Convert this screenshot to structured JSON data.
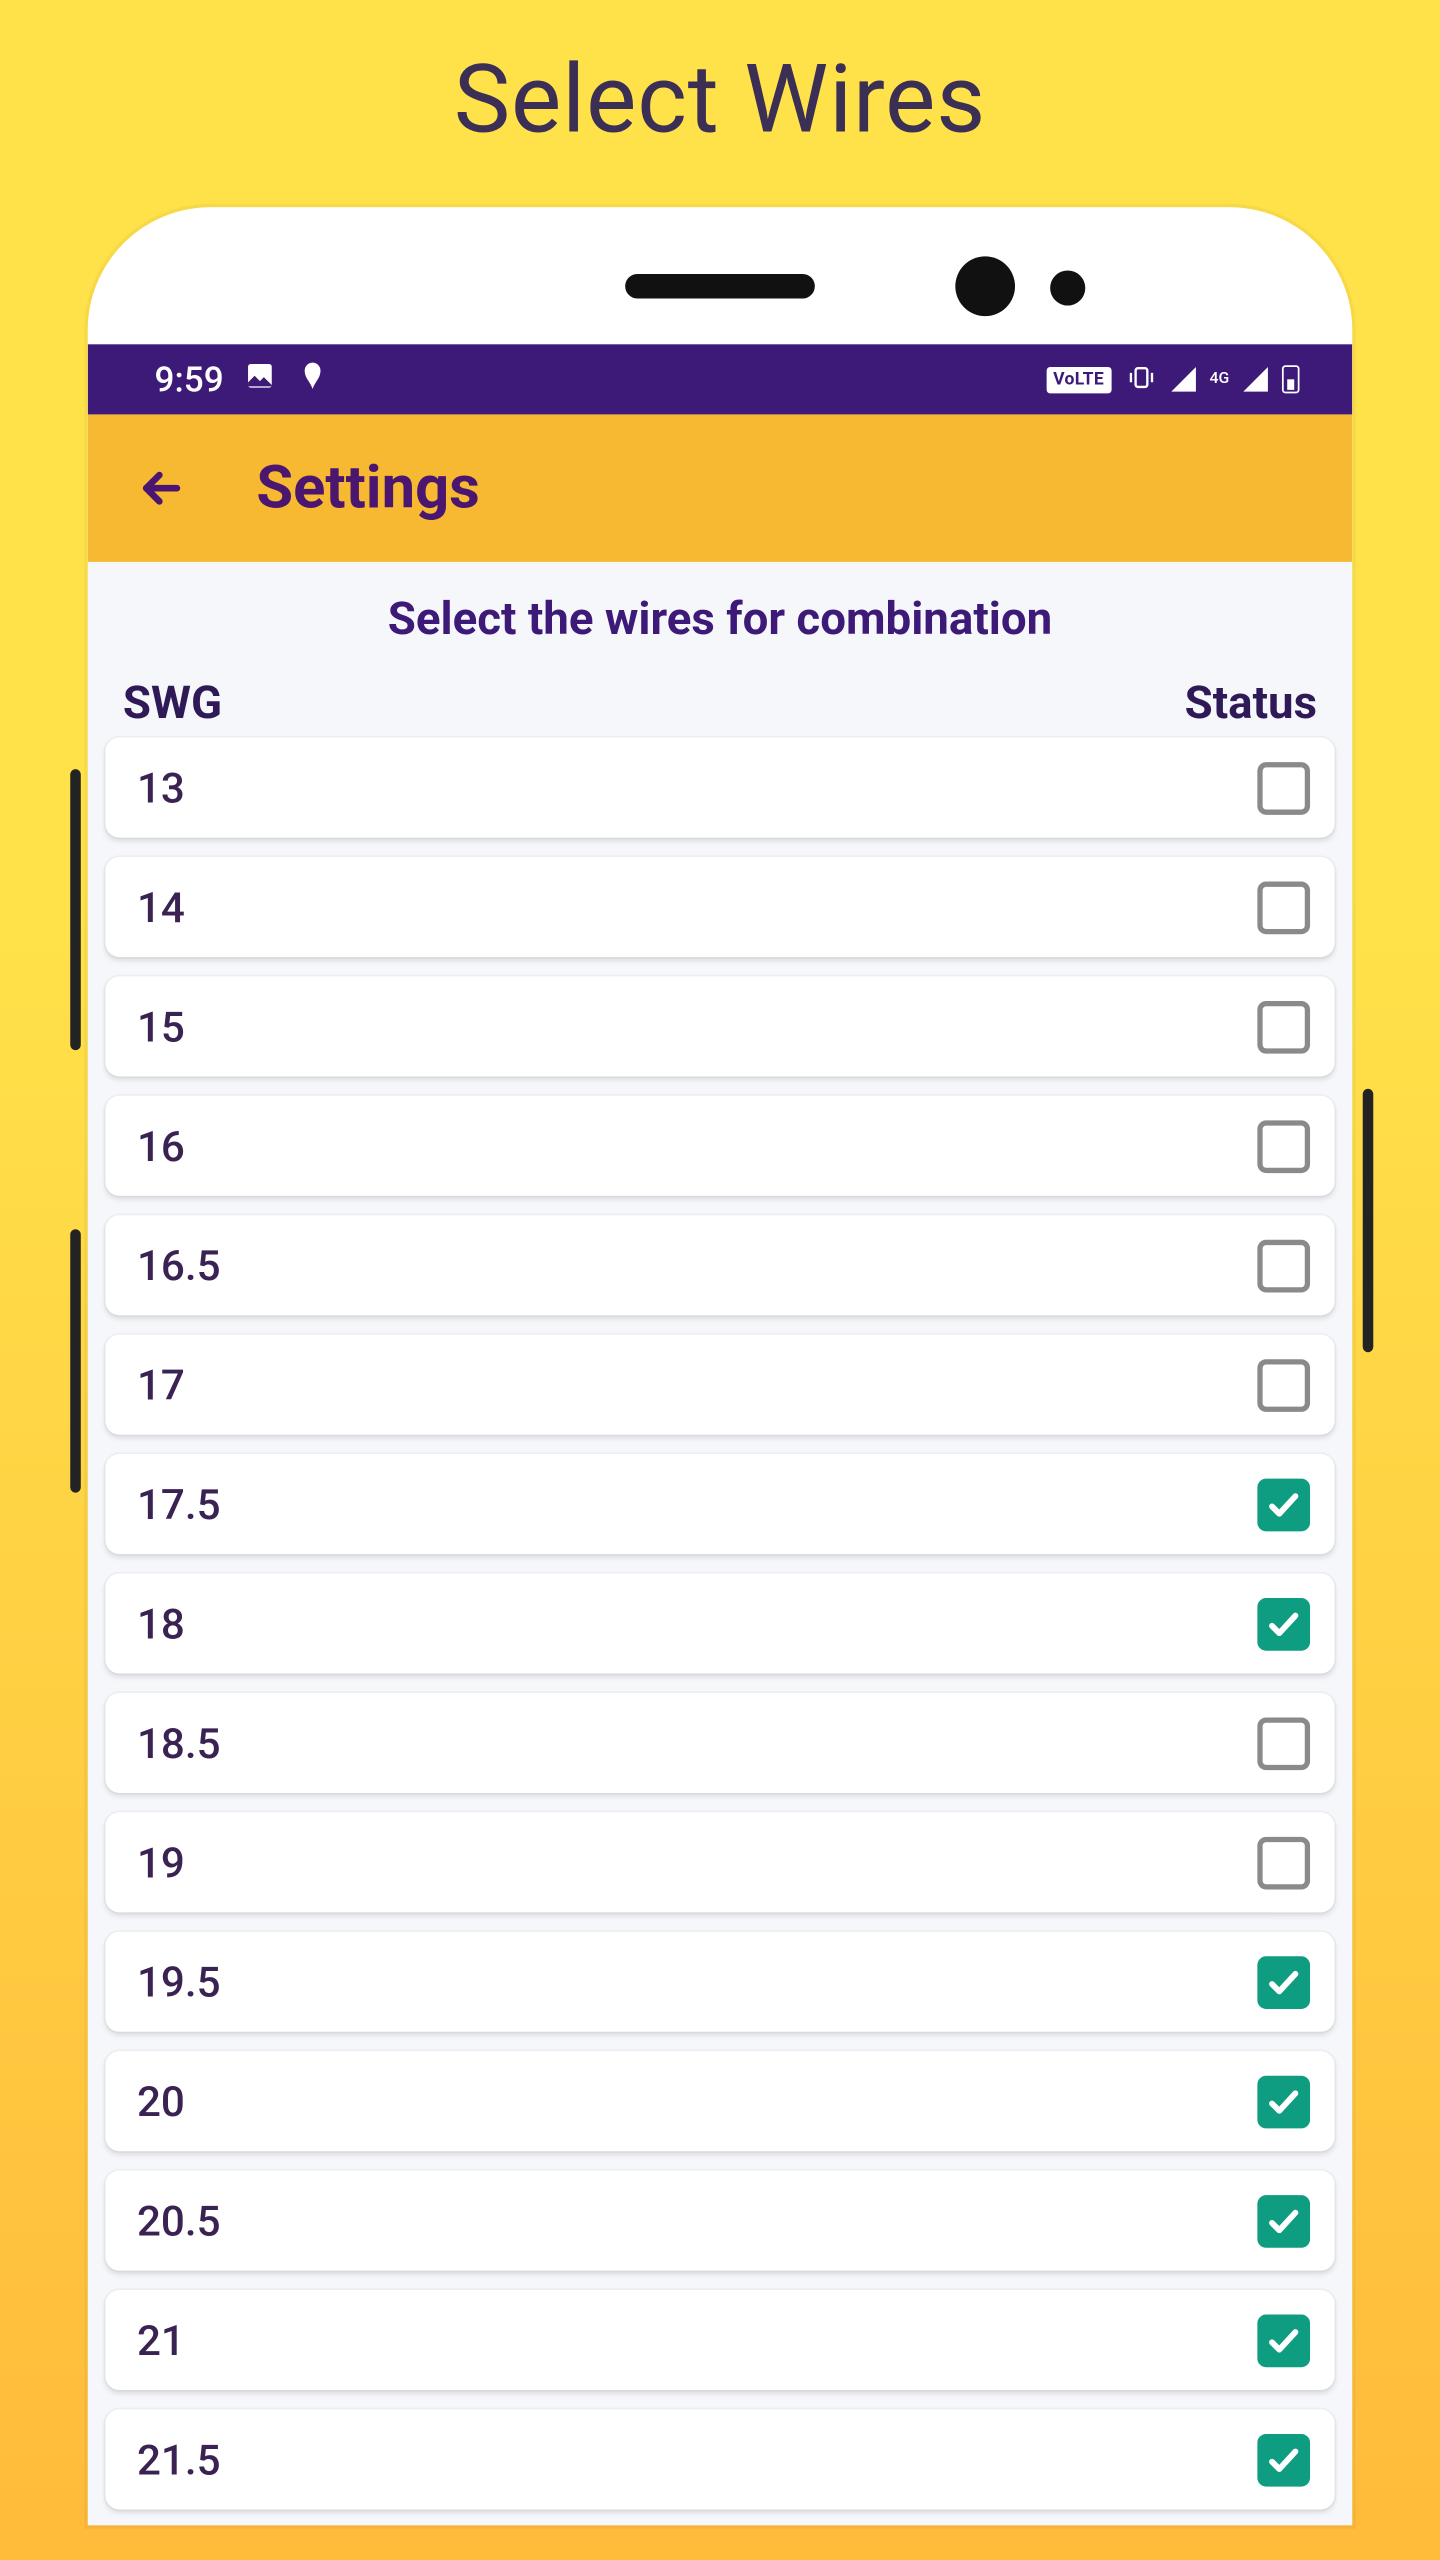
{
  "page_heading": "Select Wires",
  "statusbar": {
    "time": "9:59",
    "volte": "VoLTE",
    "net": "4G"
  },
  "appbar": {
    "title": "Settings"
  },
  "section_title": "Select the wires for combination",
  "columns": {
    "left": "SWG",
    "right": "Status"
  },
  "rows": [
    {
      "label": "13",
      "checked": false
    },
    {
      "label": "14",
      "checked": false
    },
    {
      "label": "15",
      "checked": false
    },
    {
      "label": "16",
      "checked": false
    },
    {
      "label": "16.5",
      "checked": false
    },
    {
      "label": "17",
      "checked": false
    },
    {
      "label": "17.5",
      "checked": true
    },
    {
      "label": "18",
      "checked": true
    },
    {
      "label": "18.5",
      "checked": false
    },
    {
      "label": "19",
      "checked": false
    },
    {
      "label": "19.5",
      "checked": true
    },
    {
      "label": "20",
      "checked": true
    },
    {
      "label": "20.5",
      "checked": true
    },
    {
      "label": "21",
      "checked": true
    },
    {
      "label": "21.5",
      "checked": true
    }
  ]
}
